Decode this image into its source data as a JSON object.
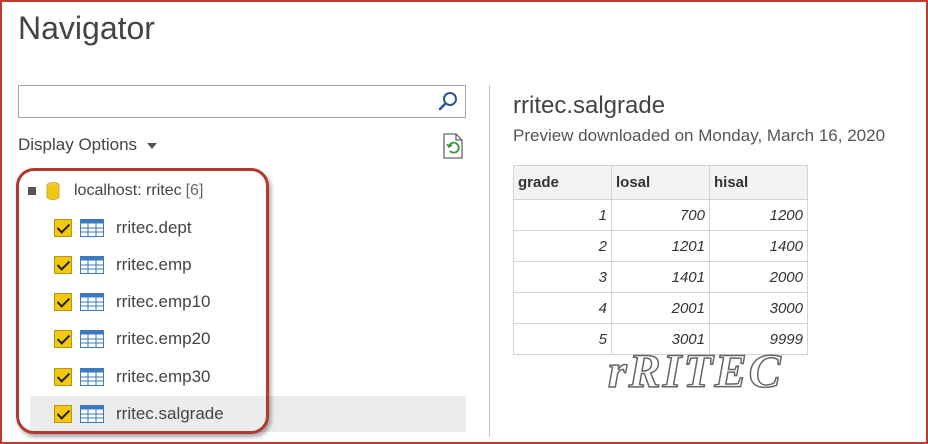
{
  "window": {
    "title": "Navigator"
  },
  "search": {
    "value": ""
  },
  "display_options": {
    "label": "Display Options"
  },
  "tree": {
    "root": {
      "label": "localhost: rritec",
      "count": "[6]"
    },
    "items": [
      {
        "label": "rritec.dept",
        "checked": true
      },
      {
        "label": "rritec.emp",
        "checked": true
      },
      {
        "label": "rritec.emp10",
        "checked": true
      },
      {
        "label": "rritec.emp20",
        "checked": true
      },
      {
        "label": "rritec.emp30",
        "checked": true
      },
      {
        "label": "rritec.salgrade",
        "checked": true,
        "selected": true
      }
    ]
  },
  "preview": {
    "title": "rritec.salgrade",
    "subtitle": "Preview downloaded on Monday, March 16, 2020",
    "columns": [
      "grade",
      "losal",
      "hisal"
    ],
    "rows": [
      [
        "1",
        "700",
        "1200"
      ],
      [
        "2",
        "1201",
        "1400"
      ],
      [
        "3",
        "1401",
        "2000"
      ],
      [
        "4",
        "2001",
        "3000"
      ],
      [
        "5",
        "3001",
        "9999"
      ]
    ]
  },
  "watermark": {
    "text": "rRITEC"
  },
  "colors": {
    "accent": "#f2c811",
    "frame": "#c0392b",
    "highlight": "#b03a2e"
  }
}
